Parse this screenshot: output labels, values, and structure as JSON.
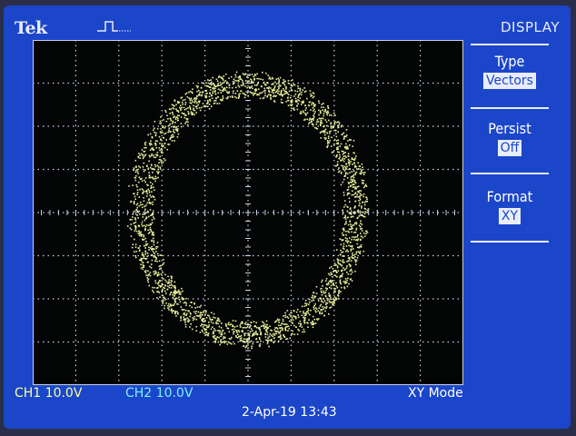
{
  "brand": "Tek",
  "menu": {
    "title": "DISPLAY",
    "items": [
      {
        "label": "Type",
        "value": "Vectors"
      },
      {
        "label": "Persist",
        "value": "Off"
      },
      {
        "label": "Format",
        "value": "XY"
      }
    ]
  },
  "status": {
    "ch1": "CH1  10.0V",
    "ch2": "CH2  10.0V",
    "mode": "XY Mode",
    "datetime": "2-Apr-19 13:43"
  },
  "trace": {
    "shape": "ring",
    "color": "#e8ee9a"
  },
  "colors": {
    "screen": "#1c46c9",
    "graticule_bg": "#030404",
    "grid": "#c8d0e8",
    "ch1": "#fbff9a",
    "ch2": "#7cf0ff"
  }
}
